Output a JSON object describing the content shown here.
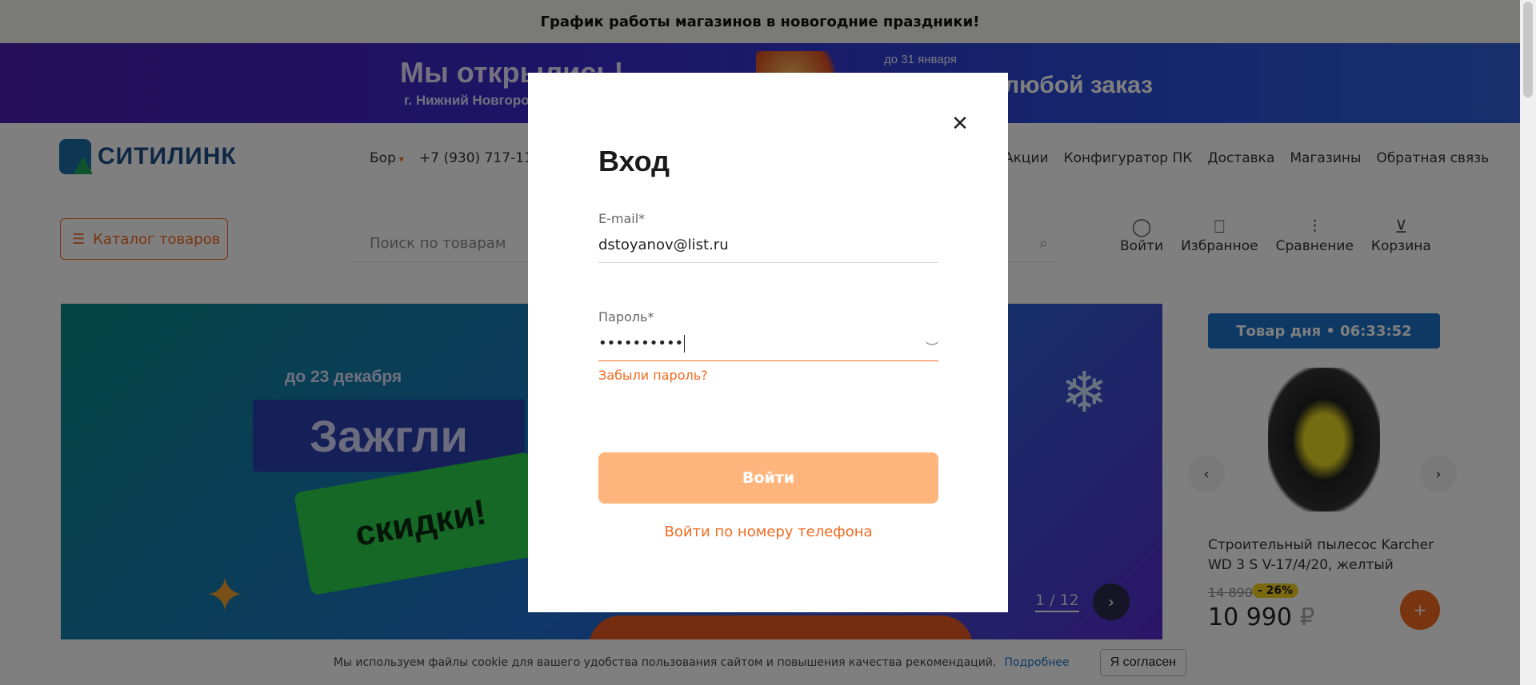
{
  "top_notice": "График работы магазинов в новогодние праздники!",
  "promo": {
    "headline": "Мы открылись!",
    "city": "г. Нижний Новгород",
    "until": "до 31 января",
    "offer": "любой заказ"
  },
  "header": {
    "logo_text": "СИТИЛИНК",
    "city": "Бор",
    "phone": "+7 (930) 717-11-6",
    "nav": [
      "Акции",
      "Конфигуратор ПК",
      "Доставка",
      "Магазины",
      "Обратная связь"
    ],
    "catalog_label": "Каталог товаров",
    "search_placeholder": "Поиск по товарам",
    "actions": [
      {
        "label": "Войти",
        "icon": "user-icon"
      },
      {
        "label": "Избранное",
        "icon": "bookmark-icon"
      },
      {
        "label": "Сравнение",
        "icon": "compare-icon"
      },
      {
        "label": "Корзина",
        "icon": "cart-icon"
      }
    ]
  },
  "hero": {
    "date": "до 23 декабря",
    "title": "Зажгли",
    "subtitle": "скидки!",
    "pager": "1 / 12"
  },
  "deal": {
    "badge": "Товар дня • 06:33:52",
    "name": "Строительный пылесос Karcher WD 3 S V-17/4/20, желтый",
    "old_price": "14 890",
    "discount": "- 26%",
    "price": "10 990",
    "currency": "₽"
  },
  "cookie": {
    "text": "Мы используем файлы cookie для вашего удобства пользования сайтом и повышения качества рекомендаций.",
    "more": "Подробнее",
    "agree": "Я согласен"
  },
  "modal": {
    "title": "Вход",
    "email_label": "E-mail",
    "email_value": "dstoyanov@list.ru",
    "password_label": "Пароль",
    "password_value": "••••••••••",
    "required_mark": "*",
    "forgot": "Забыли пароль?",
    "submit": "Войти",
    "phone_login": "Войти по номеру телефона"
  },
  "colors": {
    "accent": "#f26b21",
    "button_disabled": "#ffb57c",
    "link_blue": "#1a72c8"
  }
}
